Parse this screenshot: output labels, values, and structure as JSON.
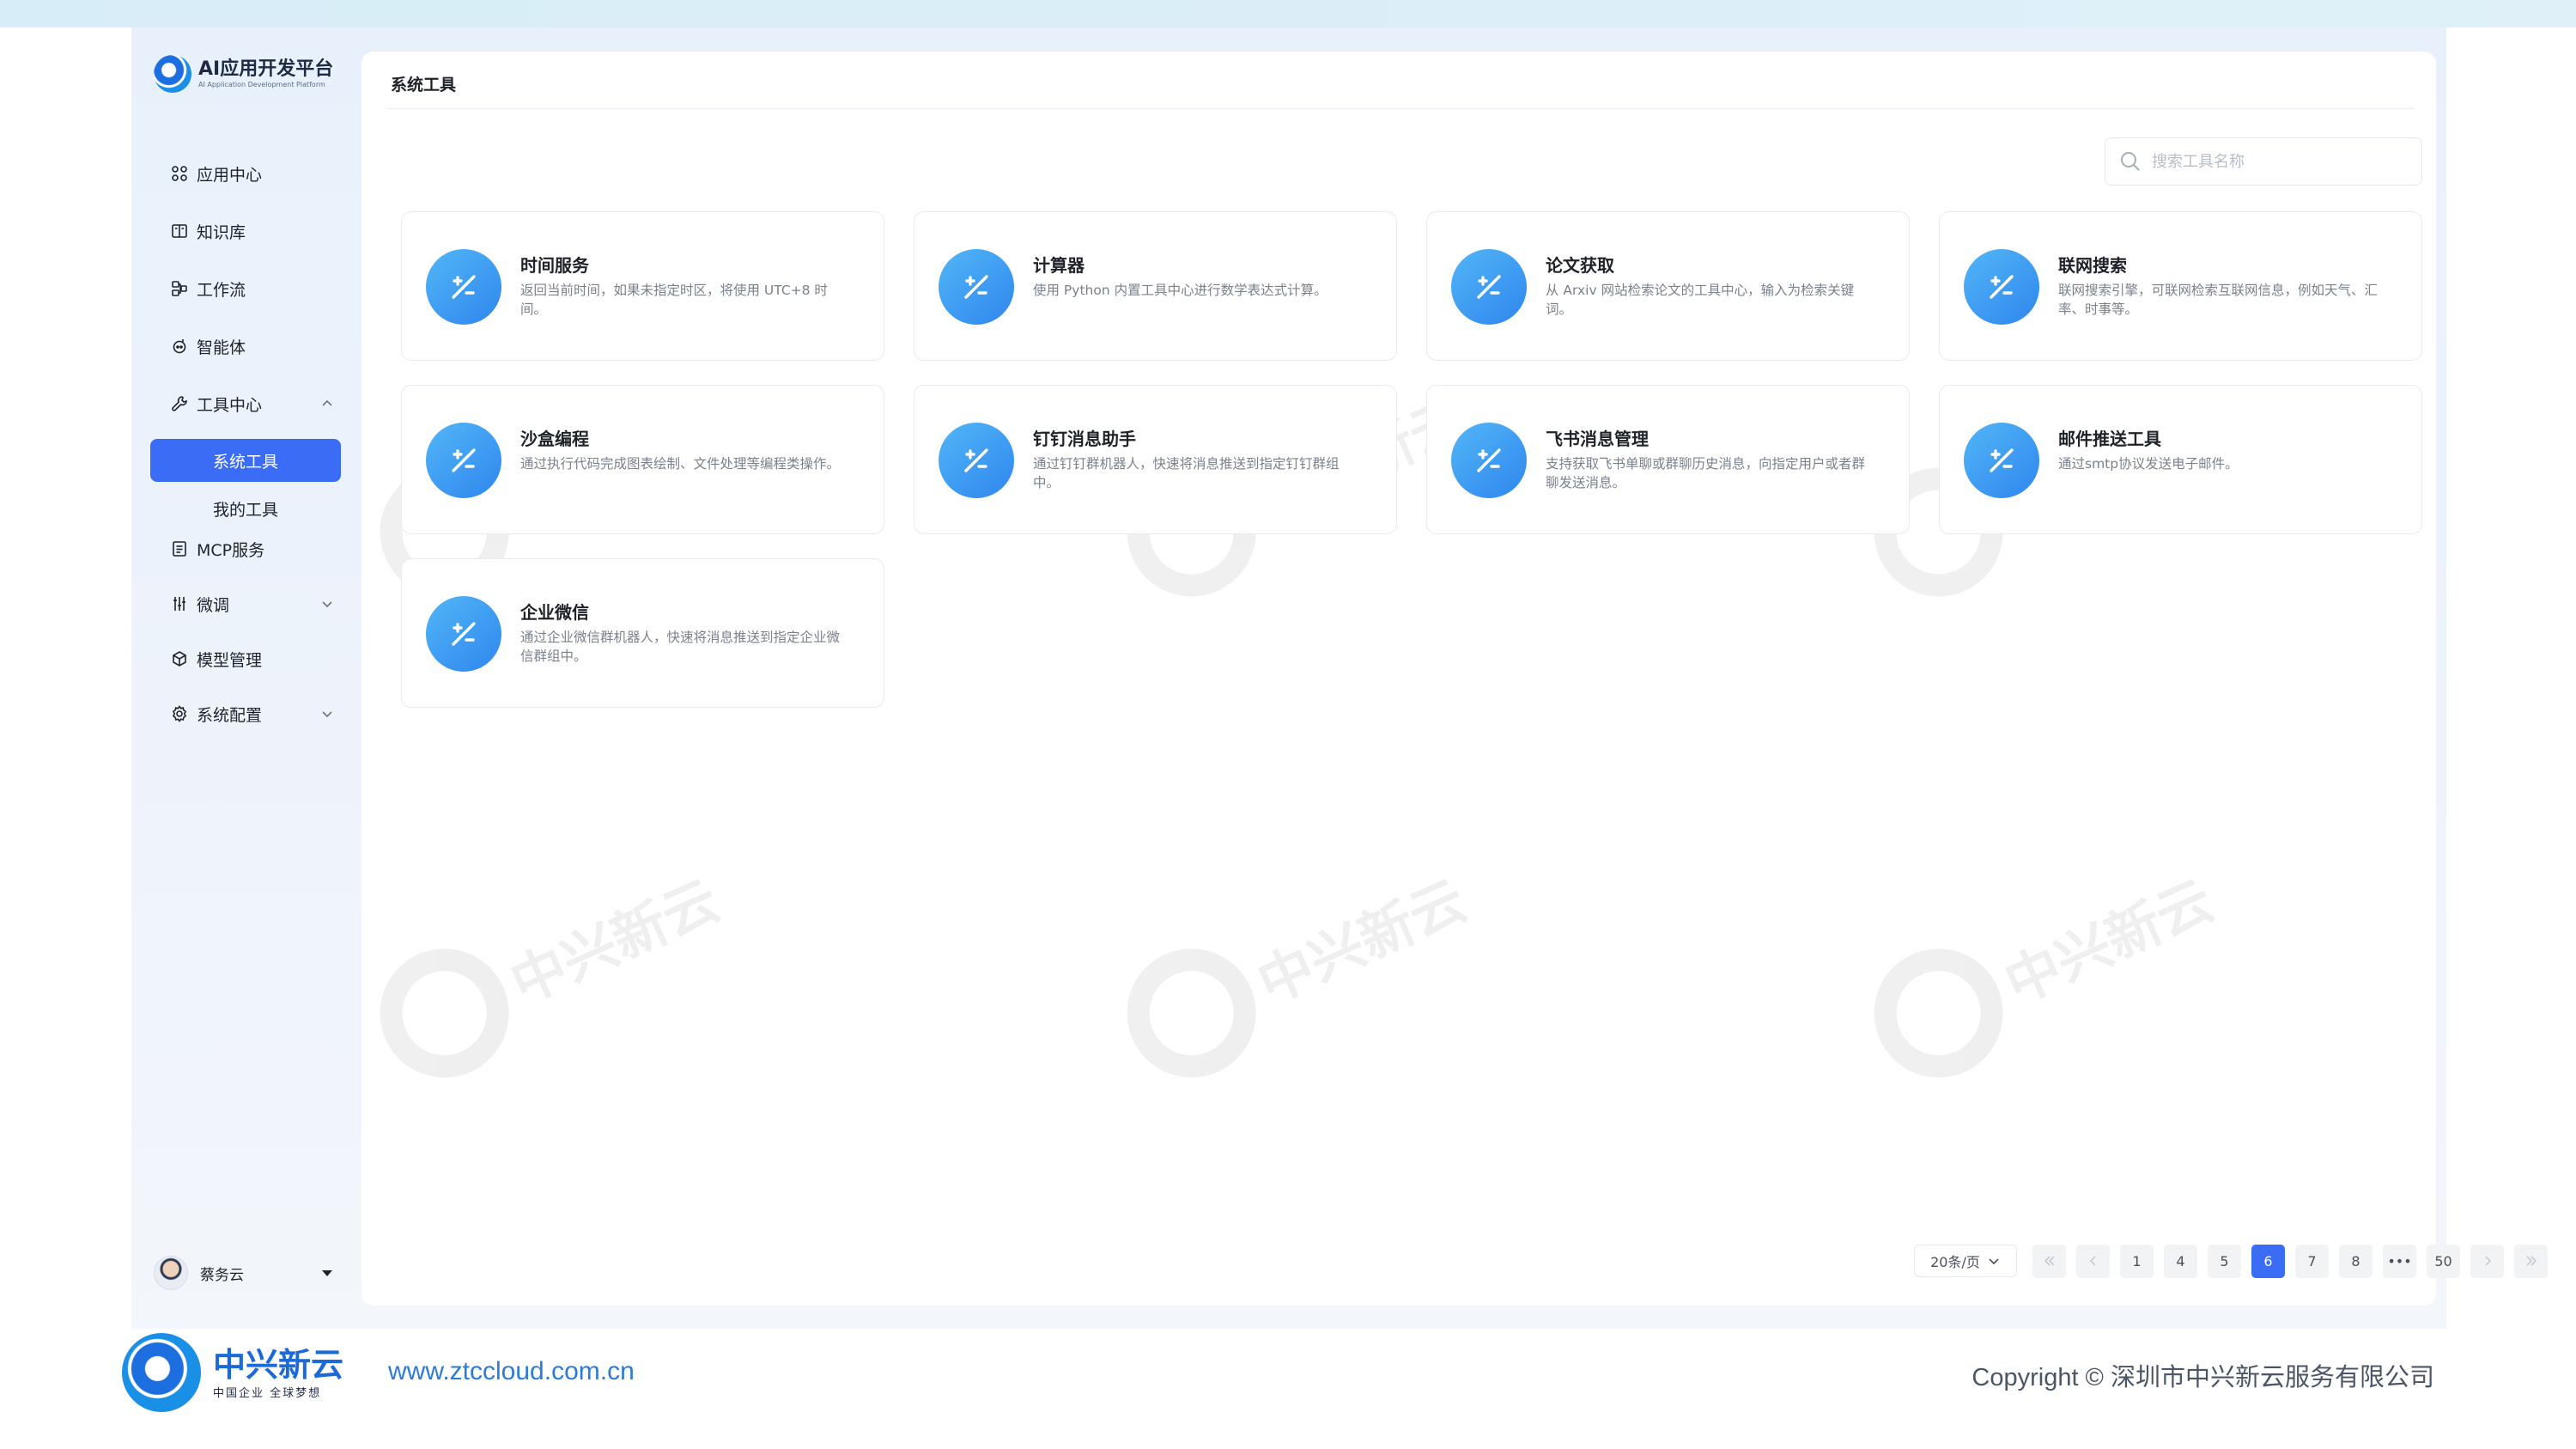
{
  "app": {
    "logo_title": "AI应用开发平台",
    "logo_subtitle": "AI Application Development Platform"
  },
  "sidebar": {
    "items": [
      {
        "label": "应用中心",
        "icon": "grid-icon"
      },
      {
        "label": "知识库",
        "icon": "book-icon"
      },
      {
        "label": "工作流",
        "icon": "workflow-icon"
      },
      {
        "label": "智能体",
        "icon": "agent-icon"
      },
      {
        "label": "工具中心",
        "icon": "wrench-icon",
        "expanded": true
      },
      {
        "label": "MCP服务",
        "icon": "document-icon"
      },
      {
        "label": "微调",
        "icon": "tune-icon",
        "expanded": false
      },
      {
        "label": "模型管理",
        "icon": "cube-icon"
      },
      {
        "label": "系统配置",
        "icon": "gear-icon",
        "expanded": false
      }
    ],
    "tool_sub_items": [
      {
        "label": "系统工具",
        "active": true
      },
      {
        "label": "我的工具",
        "active": false
      }
    ],
    "user_name": "蔡务云"
  },
  "main": {
    "title": "系统工具",
    "search_placeholder": "搜索工具名称",
    "accent": "#3b6cf6",
    "tools": [
      {
        "name": "时间服务",
        "desc": "返回当前时间，如果未指定时区，将使用 UTC+8 时间。"
      },
      {
        "name": "计算器",
        "desc": "使用 Python 内置工具中心进行数学表达式计算。"
      },
      {
        "name": "论文获取",
        "desc": "从 Arxiv 网站检索论文的工具中心，输入为检索关键词。"
      },
      {
        "name": "联网搜索",
        "desc": "联网搜索引擎，可联网检索互联网信息，例如天气、汇率、时事等。"
      },
      {
        "name": "沙盒编程",
        "desc": "通过执行代码完成图表绘制、文件处理等编程类操作。"
      },
      {
        "name": "钉钉消息助手",
        "desc": "通过钉钉群机器人，快速将消息推送到指定钉钉群组中。"
      },
      {
        "name": "飞书消息管理",
        "desc": "支持获取飞书单聊或群聊历史消息，向指定用户或者群聊发送消息。"
      },
      {
        "name": "邮件推送工具",
        "desc": "通过smtp协议发送电子邮件。"
      },
      {
        "name": "企业微信",
        "desc": "通过企业微信群机器人，快速将消息推送到指定企业微信群组中。"
      }
    ]
  },
  "pagination": {
    "page_size": "20条/页",
    "pages": [
      "1",
      "4",
      "5",
      "6",
      "7",
      "8",
      "•••",
      "50"
    ],
    "current": "6"
  },
  "watermark": {
    "text": "中兴新云"
  },
  "footer": {
    "brand": "中兴新云",
    "slogan": "中国企业 全球梦想",
    "url": "www.ztccloud.com.cn",
    "copyright": "Copyright © 深圳市中兴新云服务有限公司"
  }
}
